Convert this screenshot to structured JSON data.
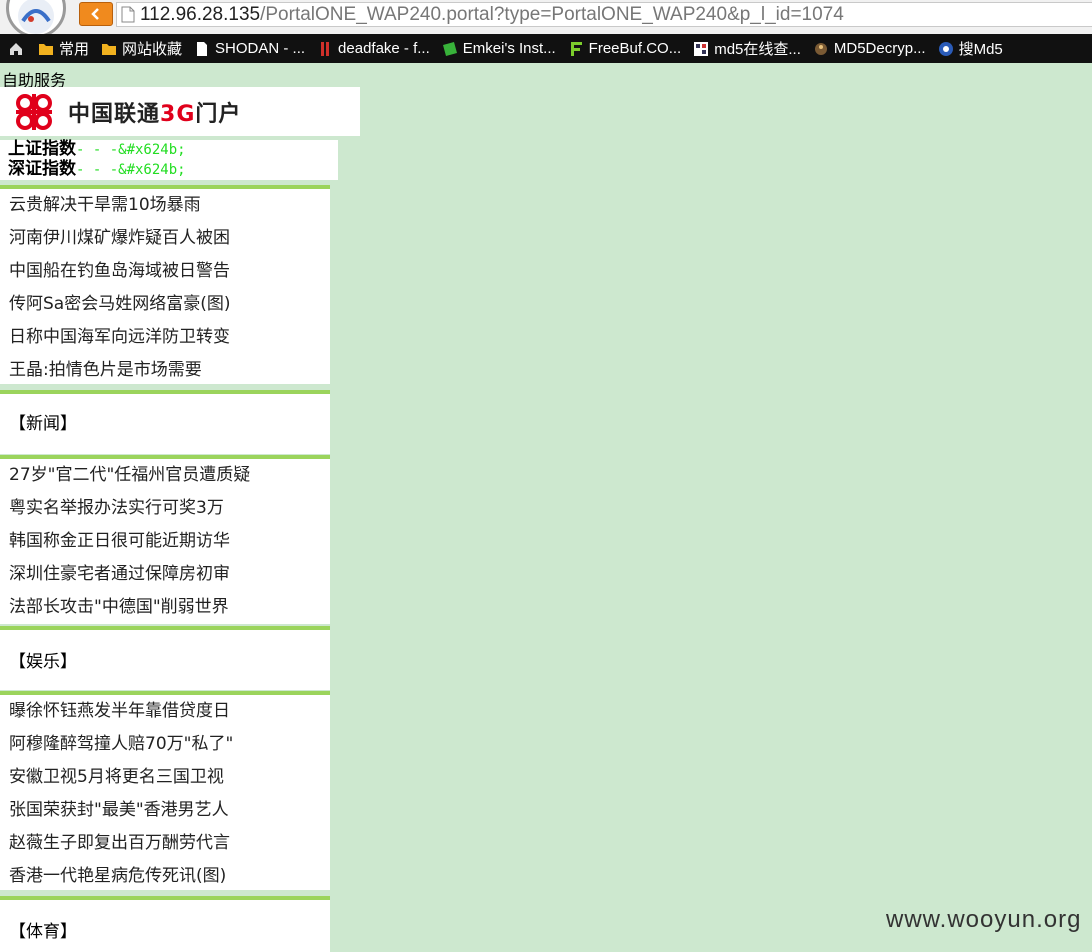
{
  "browser": {
    "address_host": "112.96.28.135",
    "address_rest": "/PortalONE_WAP240.portal?type=PortalONE_WAP240&p_l_id=1074",
    "bookmarks": [
      {
        "label": "常用",
        "icon": "folder-icon"
      },
      {
        "label": "网站收藏",
        "icon": "folder-icon"
      },
      {
        "label": "SHODAN - ...",
        "icon": "page-icon"
      },
      {
        "label": "deadfake - f...",
        "icon": "red-bars-icon"
      },
      {
        "label": "Emkei's Inst...",
        "icon": "green-arrow-icon"
      },
      {
        "label": "FreeBuf.CO...",
        "icon": "freebuf-icon"
      },
      {
        "label": "md5在线查...",
        "icon": "md5-icon"
      },
      {
        "label": "MD5Decryp...",
        "icon": "md5decrypt-icon"
      },
      {
        "label": "搜Md5",
        "icon": "search-md5-icon"
      }
    ]
  },
  "page": {
    "self_service": "自助服务",
    "logo": {
      "brand": "中国联通",
      "tag": "3G",
      "suffix": "门户"
    },
    "indices": [
      {
        "name": "上证指数",
        "value": "- - -&#x624b;"
      },
      {
        "name": "深证指数",
        "value": "- - -&#x624b;"
      }
    ],
    "headlines": [
      "云贵解决干旱需10场暴雨",
      "河南伊川煤矿爆炸疑百人被困",
      "中国船在钓鱼岛海域被日警告",
      "传阿Sa密会马姓网络富豪(图)",
      "日称中国海军向远洋防卫转变",
      "王晶:拍情色片是市场需要"
    ],
    "sections": [
      {
        "title": "【新闻】",
        "items": [
          "27岁\"官二代\"任福州官员遭质疑",
          "粤实名举报办法实行可奖3万",
          "韩国称金正日很可能近期访华",
          "深圳住豪宅者通过保障房初审",
          "法部长攻击\"中德国\"削弱世界"
        ]
      },
      {
        "title": "【娱乐】",
        "items": [
          "曝徐怀钰燕发半年靠借贷度日",
          "阿穆隆醉驾撞人赔70万\"私了\"",
          "安徽卫视5月将更名三国卫视",
          "张国荣获封\"最美\"香港男艺人",
          "赵薇生子即复出百万酬劳代言",
          "香港一代艳星病危传死讯(图)"
        ]
      },
      {
        "title": "【体育】",
        "items": []
      }
    ],
    "watermark": "www.wooyun.org"
  },
  "colors": {
    "background": "#cde8cf",
    "divider_green": "#9bd45c",
    "index_value_green": "#22dd22",
    "brand_red": "#e0001b",
    "back_button_orange": "#f08a1e"
  }
}
